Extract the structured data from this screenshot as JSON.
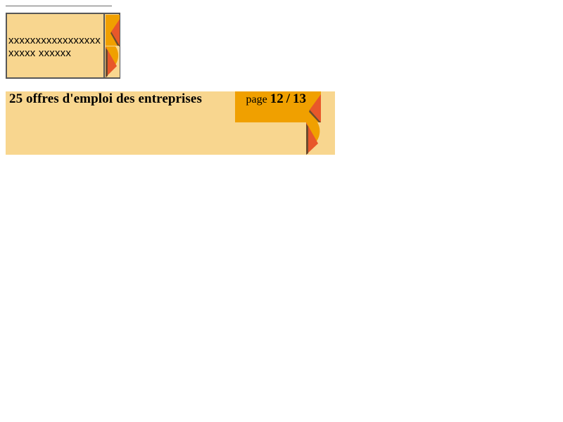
{
  "page": {
    "background_color": "#ffffff"
  },
  "widget": {
    "text": "xxxxxxxxxxxxxxxxxxxxxx xxxxxx",
    "background_color": "#f8d68f",
    "border_color": "#575757",
    "icons": [
      "page-corner-icon",
      "page-flip-icon"
    ]
  },
  "banner": {
    "title": "25 offres d'emploi des entreprises",
    "background_color": "#f8d68f"
  },
  "pager": {
    "prefix": "page",
    "current": "12",
    "separator": "/",
    "total": "13",
    "background_color": "#f0a000",
    "icons": [
      "page-corner-icon",
      "page-flip-icon"
    ]
  },
  "icon_colors": {
    "orange": "#f0a000",
    "red": "#e8572a",
    "shadow": "#6d4b2d"
  }
}
